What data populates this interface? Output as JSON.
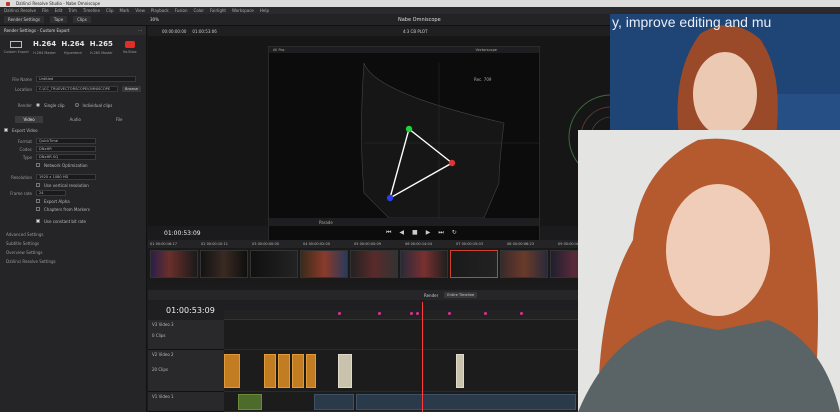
{
  "window": {
    "title": "DaVinci Resolve Studio - Nabe Omniscope"
  },
  "menu": [
    "DaVinci Resolve",
    "File",
    "Edit",
    "Trim",
    "Timeline",
    "Clip",
    "Mark",
    "View",
    "Playback",
    "Fusion",
    "Color",
    "Fairlight",
    "Workspace",
    "Help"
  ],
  "toolbar": {
    "render_settings": "Render Settings",
    "tape": "Tape",
    "clips": "Clips",
    "center_title": "Nabe Omniscope",
    "zoom": "30%",
    "ratio": "4:3 CB PLOT"
  },
  "left_panel": {
    "header": "Render Settings - Custom Export",
    "presets": [
      {
        "big": "",
        "sm": "Custom Export"
      },
      {
        "big": "H.264",
        "sm": "H.264 Master"
      },
      {
        "big": "H.264",
        "sm": "Hyperdeck"
      },
      {
        "big": "H.265",
        "sm": "H.265 Master"
      },
      {
        "big": "",
        "sm": "YouTube"
      }
    ],
    "file_name_label": "File Name",
    "file_name": "Untitled",
    "location_label": "Location",
    "location": "C:\\CC_TRUEVECTORSCOPE\\OMNISCOPE",
    "browse": "Browse",
    "render_label": "Render",
    "single_clip": "Single clip",
    "individual_clips": "Individual clips",
    "tabs": [
      "Video",
      "Audio",
      "File"
    ],
    "export_video": "Export Video",
    "format_label": "Format",
    "format": "QuickTime",
    "codec_label": "Codec",
    "codec": "DNxHR",
    "type_label": "Type",
    "type": "DNxHR SQ",
    "network_opt": "Network Optimization",
    "resolution_label": "Resolution",
    "resolution": "1920 x 1080 HD",
    "vertical_res": "Use vertical resolution",
    "frame_rate_label": "Frame rate",
    "frame_rate": "24",
    "export_alpha": "Export Alpha",
    "chapters": "Chapters from Markers",
    "constant_bitrate": "Use constant bit rate",
    "sections": [
      "Advanced Settings",
      "Subtitle Settings",
      "Overview Settings",
      "DaVinci Resolve Settings"
    ]
  },
  "viewer": {
    "tc_left": "00:00:00:00",
    "tc_right": "01:00:53:06",
    "scope_label": "All Pos",
    "scope_label2": "Vectorscope",
    "scope_tag": "Rec. 709",
    "parade_label": "Parade",
    "timecode": "01:00:53:09"
  },
  "thumbnails": {
    "clips": [
      "01 00:00:16:17",
      "02 00:00:10:11",
      "03 00:00:00:00",
      "04 00:00:02:00",
      "05 00:00:00:09",
      "06 00:00:14:04",
      "07 00:00:15:03",
      "08 00:00:06:23",
      "09 00:00:16:23"
    ]
  },
  "timeline": {
    "timecode": "01:00:53:09",
    "toolbar_label": "Render",
    "timeline_label": "Entire Timeline",
    "tracks": [
      {
        "id": "V3",
        "name": "Video 3",
        "clips": "0 Clips"
      },
      {
        "id": "V2",
        "name": "Video 2",
        "clips": "20 Clips"
      },
      {
        "id": "V1",
        "name": "Video 1",
        "clips": ""
      }
    ]
  },
  "overlay_text": "y, improve editing and mu",
  "colors": {
    "accent": "#d0402b",
    "clip_orange": "#c27d23",
    "marker": "#e02d9a"
  }
}
